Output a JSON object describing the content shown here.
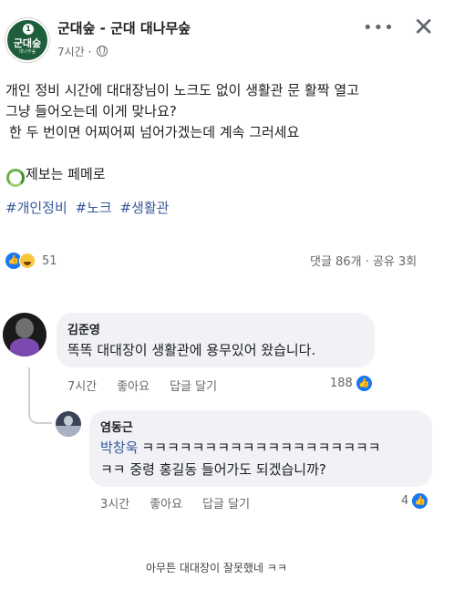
{
  "post": {
    "page_name": "군대숲 - 군대 대나무숲",
    "avatar": {
      "number": "1",
      "text": "군대숲",
      "sub": "대나무숲"
    },
    "time": "7시간",
    "separator": "·",
    "more_label": "•••",
    "close_label": "✕",
    "body_lines": [
      "개인 정비 시간에 대대장님이 노크도 없이 생활관 문 활짝 열고",
      "그냥 들어오는데 이게 맞나요?",
      "한 두 번이면 어찌어찌 넘어가겠는데 계속 그러세요"
    ],
    "reporter": "제보는 페메로",
    "hashtags": [
      "#개인정비",
      "#노크",
      "#생활관"
    ],
    "reaction_count": "51",
    "comments_count": "댓글 86개",
    "stats_separator": "·",
    "shares_count": "공유 3회"
  },
  "comments": [
    {
      "author": "김준영",
      "text": "똑똑 대대장이 생활관에 용무있어 왔습니다.",
      "time": "7시간",
      "like_label": "좋아요",
      "reply_label": "답글 달기",
      "likes": "188"
    },
    {
      "author": "염동근",
      "mention": "박창욱",
      "text_line1": "ㅋㅋㅋㅋㅋㅋㅋㅋㅋㅋㅋㅋㅋㅋㅋㅋㅋㅋㅋ",
      "text_line2": "ㅋㅋ 중령 홍길동 들어가도 되겠습니까?",
      "time": "3시간",
      "like_label": "좋아요",
      "reply_label": "답글 달기",
      "likes": "4"
    }
  ],
  "caption": "아무튼 대대장이 잘못했네 ㅋㅋ",
  "colors": {
    "facebook_blue": "#1877f2",
    "link": "#385898",
    "bubble": "#f0f2f5",
    "avatar_green": "#1f5e3b"
  },
  "icons": [
    "globe-icon",
    "more-icon",
    "close-icon",
    "recycle-icon",
    "like-icon",
    "haha-icon"
  ]
}
